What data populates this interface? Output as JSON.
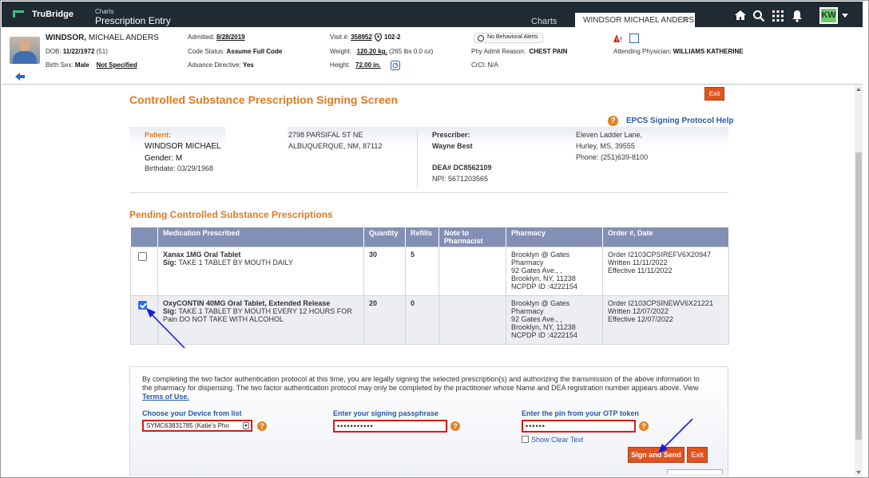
{
  "app": {
    "logo": "TruBridge",
    "section_small": "Charts",
    "title": "Prescription Entry",
    "tabs": [
      {
        "label": "Charts"
      },
      {
        "label": "WINDSOR MICHAEL ANDERS"
      }
    ],
    "user_initials": "KW"
  },
  "patient_header": {
    "last_name": "WINDSOR,",
    "first_names": " MICHAEL ANDERS",
    "dob_label": "DOB:",
    "dob": "11/22/1972",
    "age": "(51)",
    "sex_label": "Birth Sex:",
    "sex": "Male",
    "sex_extra": "Not Specified",
    "admitted_label": "Admitted:",
    "admitted": "8/28/2019",
    "code_label": "Code Status:",
    "code": "Assume Full Code",
    "advance_label": "Advance Directive:",
    "advance": "Yes",
    "visit_label": "Visit #:",
    "visit": "358952",
    "room": "102-2",
    "weight_label": "Weight:",
    "weight": "120.20 kg.",
    "weight_lbs": "(265 lbs 0.0 oz)",
    "height_label": "Height:",
    "height": "72.00 in.",
    "alerts": "No Behavioral Alerts",
    "admit_reason_label": "Phy Admit Reason:",
    "admit_reason": "CHEST PAIN",
    "crcl_label": "CrCl:",
    "crcl": "N/A",
    "attending_label": "Attending Physician:",
    "attending": "WILLIAMS KATHERINE"
  },
  "screen": {
    "title": "Controlled Substance Prescription Signing Screen",
    "exit_label": "Exit",
    "help_link": "EPCS Signing Protocol Help",
    "help_q": "?"
  },
  "patient_panel": {
    "patient_label": "Patient:",
    "patient_name": "WINDSOR MICHAEL",
    "gender": "Gender: M",
    "birthdate": "Birthdate: 03/29/1968",
    "address1": "2798 PARSIFAL ST NE",
    "address2": "ALBUQUERQUE, NM, 87112",
    "prescriber_label": "Prescriber:",
    "prescriber_name": "Wayne Best",
    "dea": "DEA# DC8562109",
    "npi": "NPI: 5671203565",
    "presc_addr1": "Eleven Ladder Lane,",
    "presc_addr2": "Hurley, MS, 39555",
    "presc_phone": "Phone: (251)639-8100"
  },
  "pending": {
    "title": "Pending Controlled Substance Prescriptions",
    "columns": [
      "Medication Prescribed",
      "Quantity",
      "Refills",
      "Note to Pharmacist",
      "Pharmacy",
      "Order #, Date"
    ],
    "rows": [
      {
        "checked": false,
        "med": "Xanax 1MG Oral Tablet",
        "sig_label": "Sig:",
        "sig": "TAKE 1 TABLET BY MOUTH DAILY",
        "quantity": "30",
        "refills": "5",
        "note": "",
        "pharmacy": [
          "Brooklyn @ Gates",
          "Pharmacy",
          "92 Gates Ave., ,",
          "Brooklyn, NY, 11238",
          "NCPDP ID :4222154"
        ],
        "order": [
          "Order I2103CPSIREFV6X20947",
          "Written 11/11/2022",
          "Effective 11/11/2022"
        ]
      },
      {
        "checked": true,
        "med": "OxyCONTIN 40MG Oral Tablet, Extended Release",
        "sig_label": "Sig:",
        "sig": "TAKE 1 TABLET BY MOUTH EVERY 12 HOURS FOR Pain DO NOT TAKE WITH ALCOHOL",
        "quantity": "20",
        "refills": "0",
        "note": "",
        "pharmacy": [
          "Brooklyn @ Gates",
          "Pharmacy",
          "92 Gates Ave., ,",
          "Brooklyn, NY, 11238",
          "NCPDP ID :4222154"
        ],
        "order": [
          "Order I2103CPSINEWV6X21221",
          "Written 12/07/2022",
          "Effective 12/07/2022"
        ]
      }
    ]
  },
  "auth": {
    "text": "By completing the two factor authentication protocol at this time, you are legally signing the selected prescription(s) and authorizing the transmission of the above information to the pharmacy for dispensing. The two factor authentication protocol may only be completed by the practitioner whose Name and DEA registration number appears above. View ",
    "terms_link": "Terms of Use.",
    "device_label": "Choose your Device from list",
    "device_value": "SYMC63831785 (Katie's Pho",
    "pass_label": "Enter your signing passphrase",
    "pass_value": "•••••••••••",
    "pin_label": "Enter the pin from your OTP token",
    "pin_value": "••••••",
    "show_clear": "Show Clear Text",
    "sign_label": "Sign and Send",
    "exit_label": "Exit"
  },
  "colors": {
    "accent_orange": "#e37a1f",
    "button_orange": "#e0541f",
    "header_dark": "#1f2a33",
    "table_header": "#8390b6",
    "highlight_red": "#d41c1c",
    "annotation_arrow": "#1a1adb"
  }
}
